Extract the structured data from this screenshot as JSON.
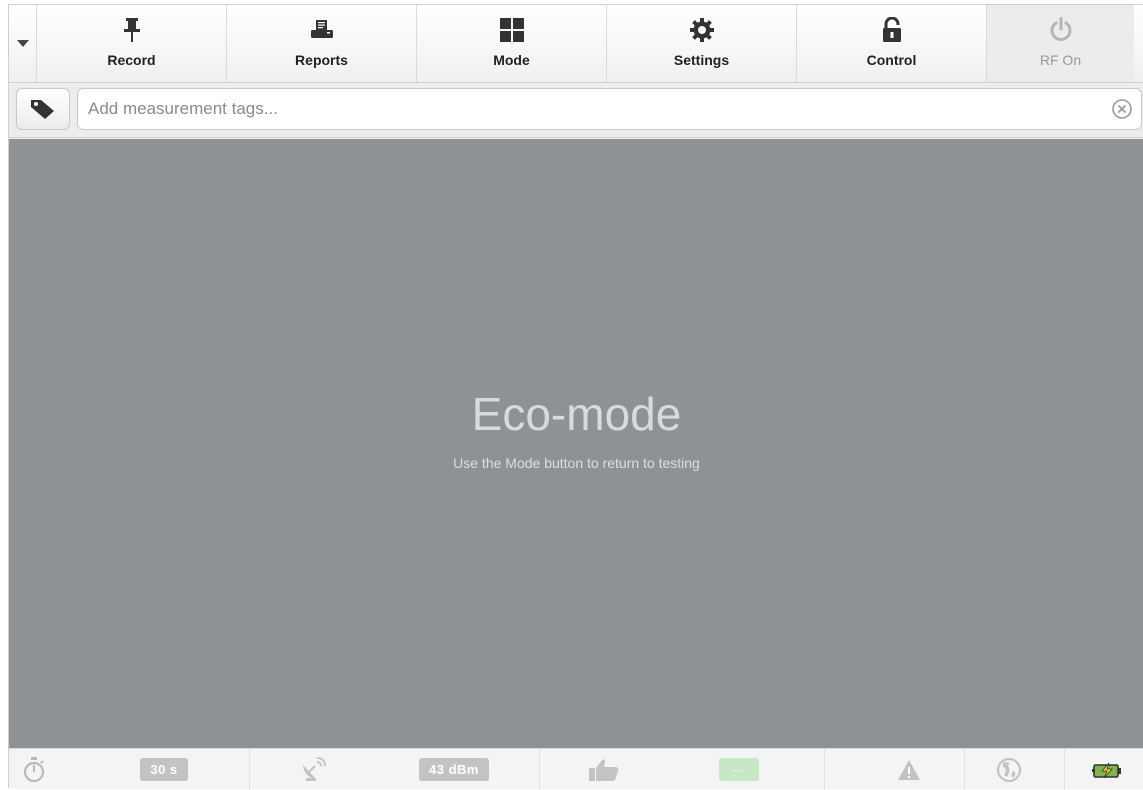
{
  "toolbar": {
    "buttons": [
      {
        "label": "Record",
        "icon": "pushpin-icon"
      },
      {
        "label": "Reports",
        "icon": "printer-icon"
      },
      {
        "label": "Mode",
        "icon": "grid-icon"
      },
      {
        "label": "Settings",
        "icon": "gear-icon"
      },
      {
        "label": "Control",
        "icon": "unlocked-padlock-icon"
      },
      {
        "label": "RF On",
        "icon": "power-icon",
        "disabled": true
      }
    ]
  },
  "tagbar": {
    "placeholder": "Add measurement tags...",
    "value": ""
  },
  "main": {
    "title": "Eco-mode",
    "subtitle": "Use the Mode button to return to testing",
    "background": "#8f9295"
  },
  "statusbar": {
    "timer_value": "30 s",
    "power_value": "43 dBm",
    "status_value": "---"
  },
  "colors": {
    "icon_dark": "#333333",
    "icon_disabled": "#b5b5b5",
    "status_green": "#c6e8c4"
  }
}
